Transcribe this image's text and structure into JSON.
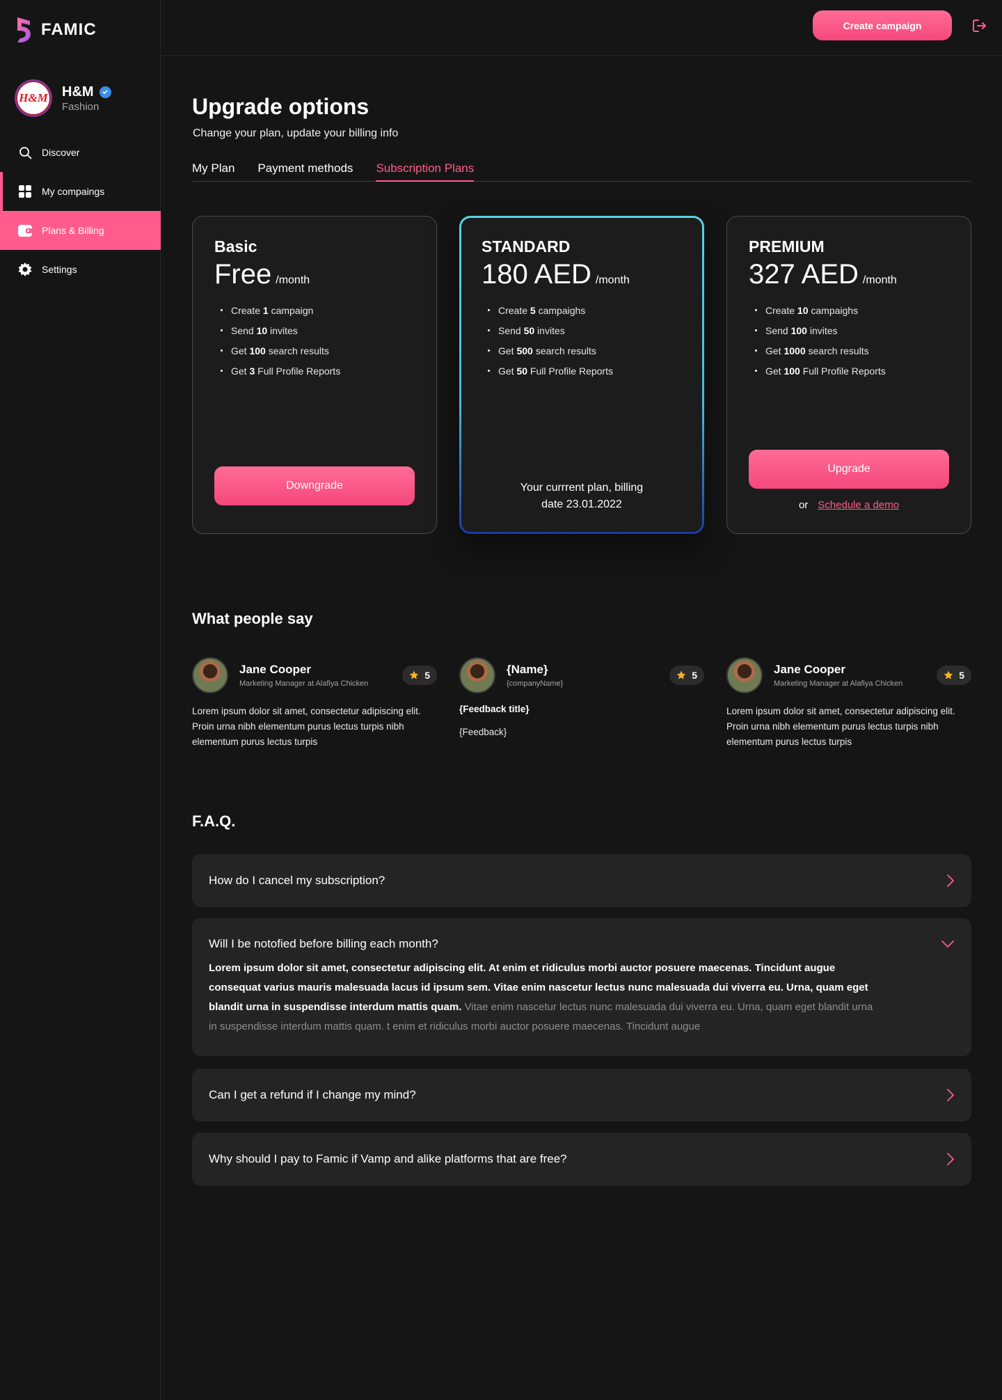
{
  "app": {
    "name": "FAMIC"
  },
  "account": {
    "name": "H&M",
    "type": "Fashion",
    "logo_text": "H&M"
  },
  "sidebar": {
    "items": [
      {
        "label": "Discover",
        "icon": "search-icon"
      },
      {
        "label": "My compaings",
        "icon": "grid-icon"
      },
      {
        "label": "Plans & Billing",
        "icon": "wallet-icon"
      },
      {
        "label": "Settings",
        "icon": "gear-icon"
      }
    ]
  },
  "topbar": {
    "create_label": "Create campaign",
    "logout_icon": "logout-icon"
  },
  "page": {
    "title": "Upgrade options",
    "subtitle": "Change your plan, update your billing info",
    "tabs": [
      "My Plan",
      "Payment methods",
      "Subscription Plans"
    ],
    "active_tab": "Subscription Plans"
  },
  "plans": [
    {
      "name": "Basic",
      "price": "Free",
      "period": "/month",
      "features": [
        {
          "pre": "Create ",
          "num": "1",
          "post": " campaign"
        },
        {
          "pre": "Send ",
          "num": "10",
          "post": " invites"
        },
        {
          "pre": "Get ",
          "num": "100",
          "post": " search results"
        },
        {
          "pre": "Get ",
          "num": "3",
          "post": " Full Profile Reports"
        }
      ],
      "action": "Downgrade"
    },
    {
      "name": "STANDARD",
      "price": "180 AED",
      "period": "/month",
      "features": [
        {
          "pre": "Create ",
          "num": "5",
          "post": " campaighs"
        },
        {
          "pre": "Send ",
          "num": "50",
          "post": " invites"
        },
        {
          "pre": "Get ",
          "num": "500",
          "post": " search results"
        },
        {
          "pre": "Get ",
          "num": "50",
          "post": " Full Profile Reports"
        }
      ],
      "note_line1": "Your currrent plan, billing",
      "note_line2": "date 23.01.2022"
    },
    {
      "name": "PREMIUM",
      "price": "327 AED",
      "period": "/month",
      "features": [
        {
          "pre": "Create ",
          "num": "10",
          "post": " campaighs"
        },
        {
          "pre": "Send ",
          "num": "100",
          "post": " invites"
        },
        {
          "pre": "Get ",
          "num": "1000",
          "post": " search results"
        },
        {
          "pre": "Get ",
          "num": "100",
          "post": " Full Profile Reports"
        }
      ],
      "action": "Upgrade",
      "or": "or",
      "demo_link": "Schedule a demo"
    }
  ],
  "testimonials": {
    "title": "What people say",
    "items": [
      {
        "name": "Jane Cooper",
        "role": "Marketing Manager at Alafiya Chicken",
        "rating": "5",
        "text": "Lorem ipsum dolor sit amet, consectetur adipiscing elit. Proin urna nibh elementum purus lectus turpis nibh elementum purus lectus turpis"
      },
      {
        "name": "{Name}",
        "role": "{companyName}",
        "rating": "5",
        "feedback_title": "{Feedback title}",
        "feedback": "{Feedback}"
      },
      {
        "name": "Jane Cooper",
        "role": "Marketing Manager at Alafiya Chicken",
        "rating": "5",
        "text": "Lorem ipsum dolor sit amet, consectetur adipiscing elit. Proin urna nibh elementum purus lectus turpis nibh elementum purus lectus turpis"
      }
    ]
  },
  "faq": {
    "title": "F.A.Q.",
    "items": [
      {
        "q": "How do I cancel my subscription?"
      },
      {
        "q": "Will I be notofied before billing each month?",
        "a_strong": "Lorem ipsum dolor sit amet, consectetur adipiscing elit. At enim et ridiculus morbi auctor posuere maecenas. Tincidunt augue consequat varius mauris malesuada lacus id ipsum sem. Vitae enim nascetur lectus nunc malesuada dui viverra eu. Urna, quam eget blandit urna in suspendisse interdum mattis quam.",
        "a_muted": " Vitae enim nascetur lectus nunc malesuada dui viverra eu. Urna, quam eget blandit urna in suspendisse interdum mattis quam. t enim et ridiculus morbi auctor posuere maecenas. Tincidunt augue"
      },
      {
        "q": "Can I get a refund if I change my mind?"
      },
      {
        "q": "Why should I pay to Famic if Vamp and alike platforms that are free?"
      }
    ]
  },
  "colors": {
    "accent": "#ff5c8d",
    "background": "#151515",
    "card": "#1c1c1c",
    "current_border": "#59d3e3",
    "star": "#f5b32a",
    "verified": "#3b8fe8"
  }
}
